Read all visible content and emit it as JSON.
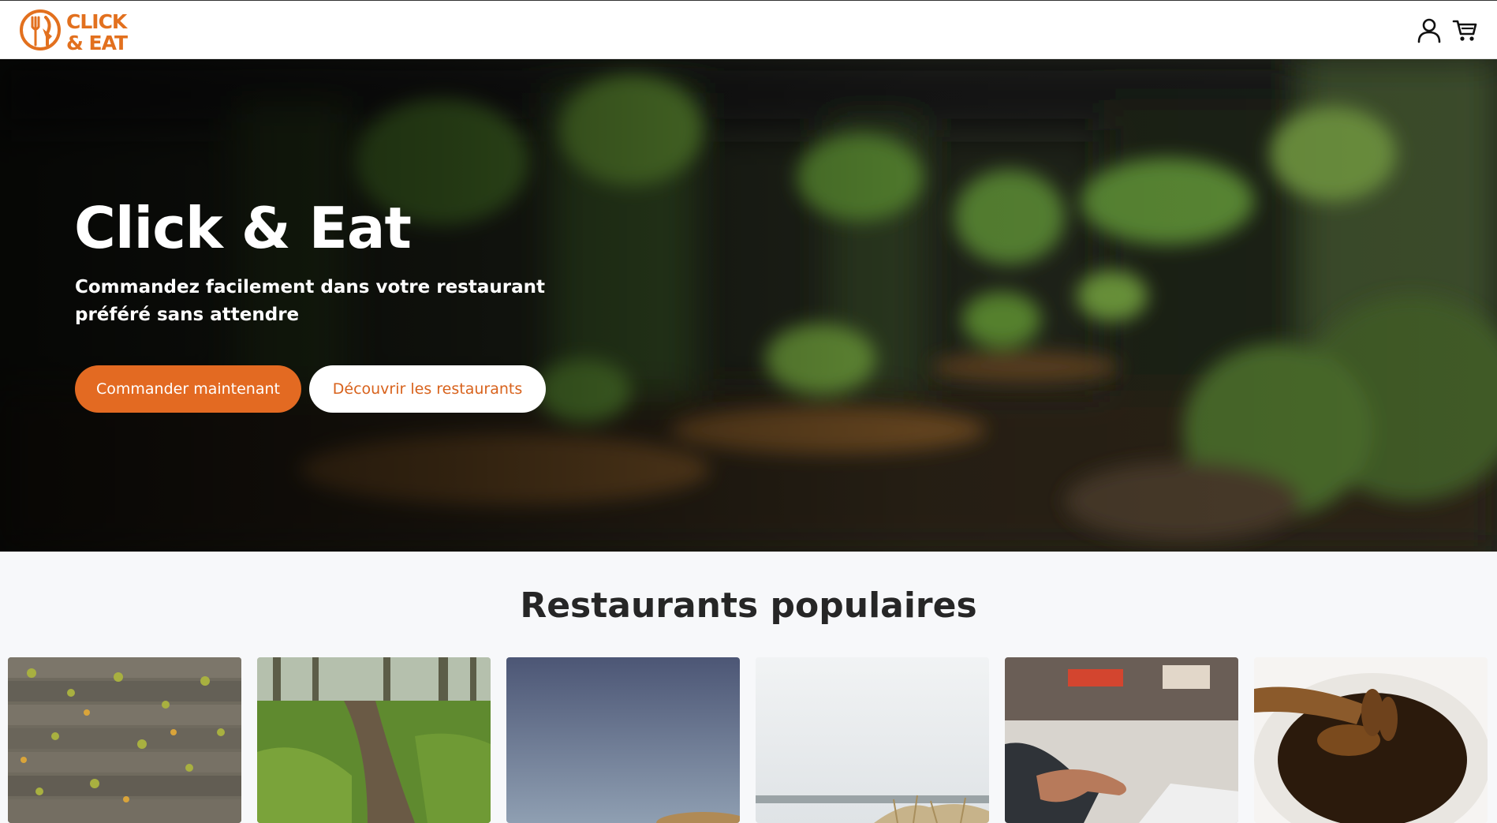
{
  "app": {
    "brand": {
      "line1": "CLICK",
      "line2": "& EAT",
      "color": "#e2701e"
    }
  },
  "header": {
    "icons": [
      "user-icon",
      "cart-icon"
    ]
  },
  "hero": {
    "title": "Click & Eat",
    "subtitle": "Commandez facilement dans votre restaurant préféré sans attendre",
    "primary_cta": "Commander maintenant",
    "secondary_cta": "Découvrir les restaurants",
    "accent": "#e36a22"
  },
  "popular": {
    "title": "Restaurants populaires",
    "cards": [
      {
        "image": "wooden-deck-leaves-image"
      },
      {
        "image": "forest-path-image"
      },
      {
        "image": "sky-dune-image"
      },
      {
        "image": "beach-grass-image"
      },
      {
        "image": "laptop-hands-image"
      },
      {
        "image": "honey-dipper-image"
      }
    ]
  }
}
